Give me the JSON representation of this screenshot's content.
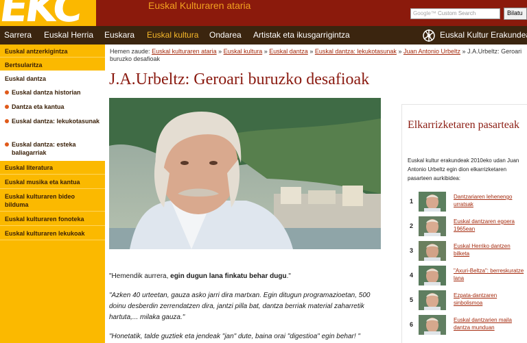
{
  "header": {
    "logo_text": "EKC",
    "site_title": "Euskal Kulturaren ataria",
    "search_placeholder": "Custom Search",
    "search_button": "Bilatu"
  },
  "nav": {
    "items": [
      "Sarrera",
      "Euskal Herria",
      "Euskara",
      "Euskal kultura",
      "Ondarea",
      "Artistak eta ikusgarrigintza"
    ],
    "active_index": 3,
    "org_label": "Euskal Kultur Erakundea"
  },
  "sidebar": {
    "items_top": [
      "Euskal antzerkigintza",
      "Bertsularitza"
    ],
    "section_title": "Euskal dantza",
    "sub_items": [
      "Euskal dantza historian",
      "Dantza eta kantua",
      "Euskal dantza: lekukotasunak",
      "Euskal dantza: esteka baliagarriak"
    ],
    "items_bottom": [
      "Euskal literatura",
      "Euskal musika eta kantua",
      "Euskal kulturaren bideo bilduma",
      "Euskal kulturaren fonoteka",
      "Euskal kulturaren lekukoak"
    ]
  },
  "breadcrumb": {
    "prefix": "Hemen zaude:",
    "links": [
      "Euskal kulturaren ataria",
      "Euskal kultura",
      "Euskal dantza",
      "Euskal dantza: lekukotasunak",
      "Juan Antonio Urbeltz"
    ],
    "separator": "»",
    "current": "J.A.Urbeltz: Geroari buruzko desafioak"
  },
  "page_title": "J.A.Urbeltz: Geroari buruzko desafioak",
  "quotes": {
    "q1_a": "\"Hemendik aurrera, ",
    "q1_b": "egin dugun lana finkatu behar dugu",
    "q1_c": ".\"",
    "q2": "\"Azken 40 urteetan, gauza asko jarri dira martxan. Egin ditugun programazioetan, 500 doinu desberdin zerrendatzen dira, jantzi pilla bat, dantza berriak material zaharretik hartuta,... milaka gauza.\"",
    "q3": "\"Honetatik, talde guztiek eta jendeak \"jan\" dute, baina orai \"digestioa\" egin behar! \""
  },
  "right": {
    "title": "Elkarrizketaren pasarteak",
    "description": "Euskal kultur erakundeak 2010eko udan Juan Antonio Urbeltz egin dion elkarrizketaren pasarteen aurkibidea:",
    "items": [
      {
        "num": "1",
        "label": "Dantzariaren lehenengo urratsak"
      },
      {
        "num": "2",
        "label": "Euskal dantzaren egoera 1965ean"
      },
      {
        "num": "3",
        "label": "Euskal Herriko dantzen bilketa"
      },
      {
        "num": "4",
        "label": "\"Axuri-Beltza\": berreskuratze lana"
      },
      {
        "num": "5",
        "label": "Ezpata-dantzaren sinbolismoa"
      },
      {
        "num": "6",
        "label": "Euskal dantzarien maila dantza munduan"
      }
    ]
  },
  "colors": {
    "header_bg": "#8b1a0c",
    "logo_yellow": "#fbb800",
    "nav_bg": "#3b250f",
    "nav_active": "#f7b82a",
    "sidebar_bg": "#fbb900",
    "title_red": "#8a1a10",
    "link_red": "#a4290c"
  }
}
